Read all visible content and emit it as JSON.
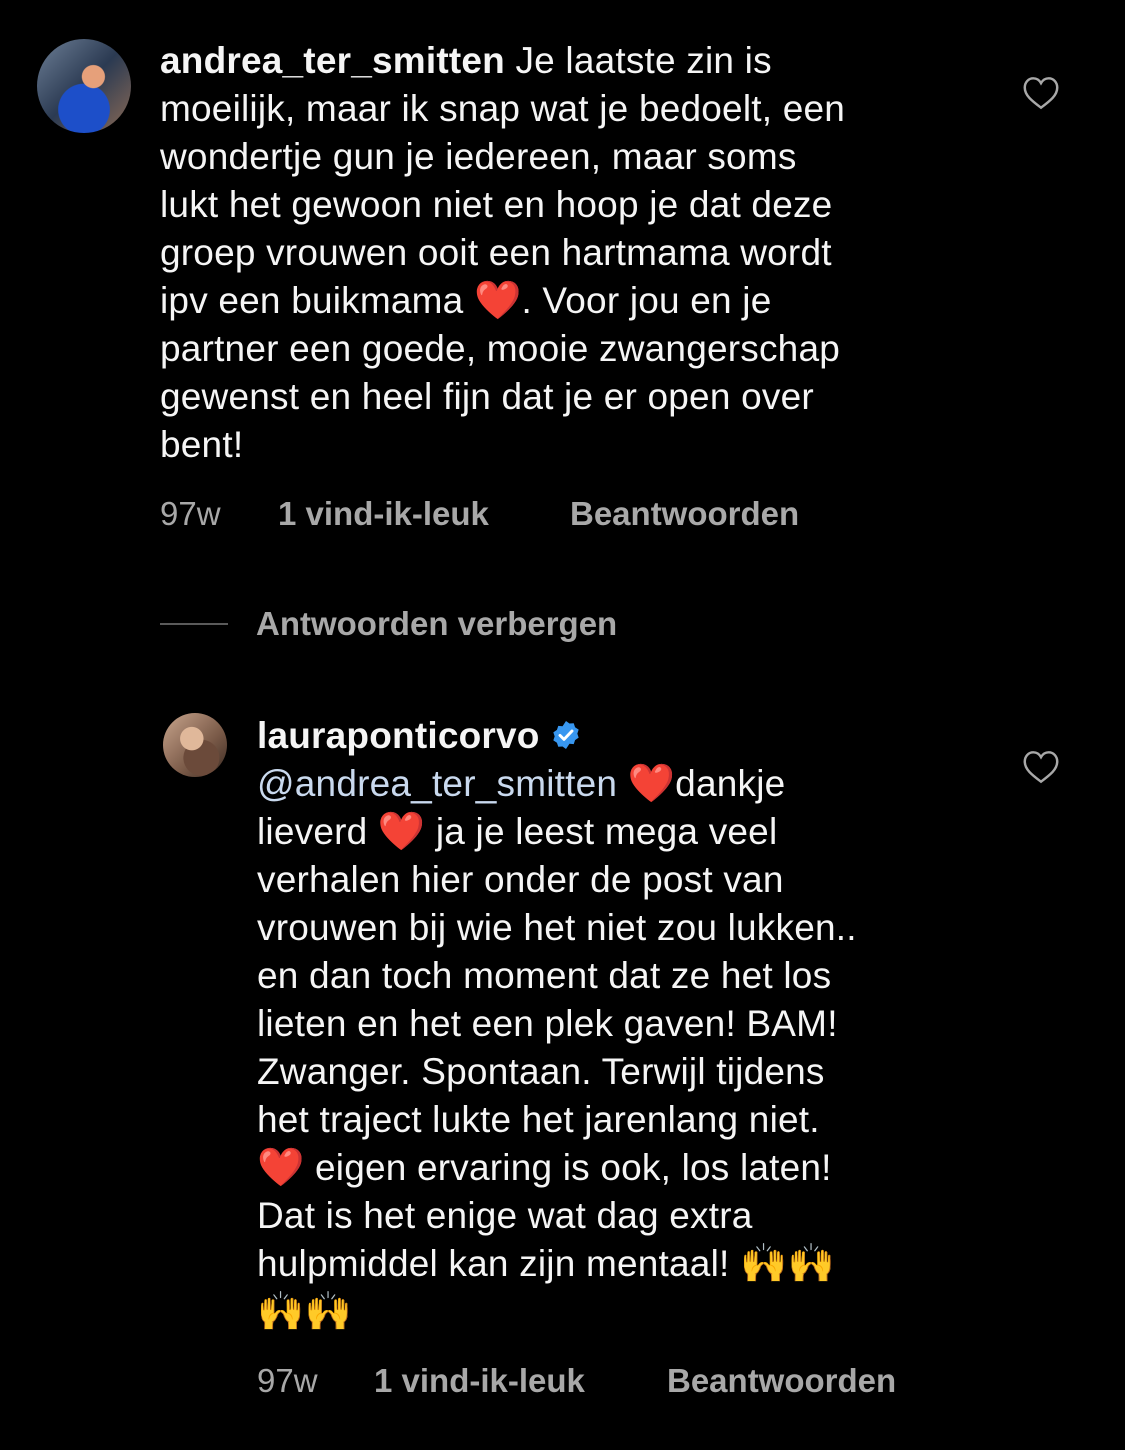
{
  "comment_1": {
    "username": "andrea_ter_smitten",
    "text_lines": [
      " Je laatste zin is",
      "moeilijk, maar ik snap wat je bedoelt, een",
      "wondertje gun je iedereen, maar soms",
      "lukt het gewoon niet en hoop je dat deze",
      "groep vrouwen ooit een hartmama wordt"
    ],
    "line6_before_emoji": "ipv een buikmama ",
    "line6_emoji": "❤️",
    "line6_after_emoji": ". Voor jou en je",
    "text_lines_end": [
      "partner een goede, mooie zwangerschap",
      "gewenst en heel fijn dat je er open over",
      "bent!"
    ],
    "time": "97w",
    "likes": "1 vind-ik-leuk",
    "reply": "Beantwoorden",
    "like_icon": "heart-outline-icon"
  },
  "hide_replies": {
    "label": "Antwoorden verbergen"
  },
  "comment_2": {
    "username": "lauraponticorvo",
    "verified_icon": "verified-badge-icon",
    "mention": "@andrea_ter_smitten",
    "heart": "❤️",
    "line1_after": "dankje",
    "line2_before": "lieverd ",
    "line2_after": " ja je leest mega veel",
    "middle_lines": [
      "verhalen hier onder de post van",
      "vrouwen bij wie het niet zou lukken..",
      "en dan toch moment dat ze het los",
      "lieten en het een plek gaven! BAM!",
      "Zwanger. Spontaan. Terwijl tijdens",
      "het traject lukte het jarenlang niet."
    ],
    "line9_after": " eigen ervaring is ook, los laten!",
    "line10": "Dat is het enige wat dag extra",
    "line11_text": "hulpmiddel kan zijn mentaal! ",
    "hands": "🙌🙌",
    "line12_hands": "🙌🙌",
    "time": "97w",
    "likes": "1 vind-ik-leuk",
    "reply": "Beantwoorden",
    "like_icon": "heart-outline-icon"
  },
  "colors": {
    "background": "#000000",
    "text": "#f5f5f5",
    "meta": "#a8a8a8",
    "mention": "#c9d9ee",
    "verified": "#3897f0"
  }
}
